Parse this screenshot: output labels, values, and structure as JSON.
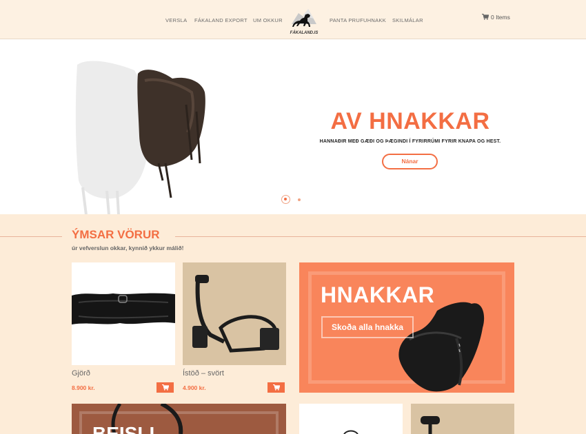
{
  "nav": {
    "items": [
      "VERSLA",
      "FÁKALAND EXPORT",
      "UM OKKUR",
      "PANTA PRUFUHNAKK",
      "SKILMÁLAR"
    ],
    "logo_text": "FÁKALAND.IS",
    "cart_label": "0 Items"
  },
  "hero": {
    "title": "AV HNAKKAR",
    "subtitle": "HANNAÐIR MEÐ GÆÐI OG ÞÆGINDI Í FYRIRRÚMI FYRIR KNAPA OG HEST.",
    "button_label": "Nánar",
    "slides_count": 2,
    "active_slide": 1
  },
  "section": {
    "title": "ÝMSAR VÖRUR",
    "subtitle": "úr vefverslun okkar, kynnið ykkur málið!"
  },
  "products": [
    {
      "name": "Gjörð",
      "price": "8.900 kr.",
      "image": "girth-image"
    },
    {
      "name": "Ístöð – svört",
      "price": "4.900 kr.",
      "image": "stirrups-image"
    }
  ],
  "promo": {
    "title": "HNAKKAR",
    "button_label": "Skoða alla hnakka"
  },
  "bottom_promo": {
    "title_partial": "BEISLI"
  },
  "colors": {
    "accent": "#f36e43",
    "background": "#fdecd8",
    "header": "#fdf1e2",
    "promo": "#f9855b",
    "promo_bottom": "#9d5a40"
  }
}
